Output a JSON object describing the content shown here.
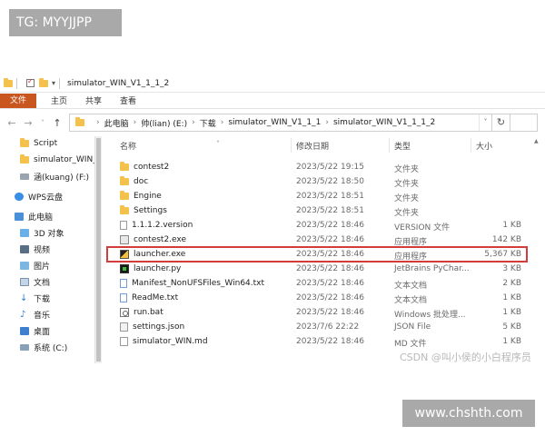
{
  "overlay": {
    "tg_label": "TG: MYYJJPP",
    "site_label": "www.chshth.com",
    "csdn_label": "CSDN @叫小侯的小白程序员"
  },
  "window": {
    "title": "simulator_WIN_V1_1_1_2",
    "quick_access_more": "▾"
  },
  "ribbon": {
    "tabs": [
      "文件",
      "主页",
      "共享",
      "查看"
    ]
  },
  "nav": {
    "back": "←",
    "forward": "→",
    "recent": "˅",
    "up": "↑",
    "refresh": "↻",
    "address_dropdown": "˅"
  },
  "breadcrumb": [
    "此电脑",
    "帅(lian) (E:)",
    "下载",
    "simulator_WIN_V1_1_1",
    "simulator_WIN_V1_1_1_2"
  ],
  "breadcrumb_sep": "›",
  "sidebar": {
    "items": [
      {
        "label": "Script",
        "icon": "folder-icon"
      },
      {
        "label": "simulator_WIN_",
        "icon": "folder-icon"
      },
      {
        "label": "涵(kuang) (F:)",
        "icon": "drive-icon"
      },
      {
        "label": "WPS云盘",
        "icon": "cloud-icon"
      },
      {
        "label": "此电脑",
        "icon": "computer-icon"
      },
      {
        "label": "3D 对象",
        "icon": "3d-objects-icon"
      },
      {
        "label": "视频",
        "icon": "video-icon"
      },
      {
        "label": "图片",
        "icon": "pictures-icon"
      },
      {
        "label": "文档",
        "icon": "documents-icon"
      },
      {
        "label": "下载",
        "icon": "downloads-icon"
      },
      {
        "label": "音乐",
        "icon": "music-icon"
      },
      {
        "label": "桌面",
        "icon": "desktop-icon"
      },
      {
        "label": "系统 (C:)",
        "icon": "system-drive-icon"
      }
    ]
  },
  "columns": {
    "name": "名称",
    "date": "修改日期",
    "type": "类型",
    "size": "大小",
    "sort_indicator": "˄"
  },
  "files": [
    {
      "name": "contest2",
      "date": "2023/5/22 19:15",
      "type": "文件夹",
      "size": "",
      "icon": "folder-icon"
    },
    {
      "name": "doc",
      "date": "2023/5/22 18:50",
      "type": "文件夹",
      "size": "",
      "icon": "folder-icon"
    },
    {
      "name": "Engine",
      "date": "2023/5/22 18:51",
      "type": "文件夹",
      "size": "",
      "icon": "folder-icon"
    },
    {
      "name": "Settings",
      "date": "2023/5/22 18:51",
      "type": "文件夹",
      "size": "",
      "icon": "folder-icon"
    },
    {
      "name": "1.1.1.2.version",
      "date": "2023/5/22 18:46",
      "type": "VERSION 文件",
      "size": "1 KB",
      "icon": "file-icon"
    },
    {
      "name": "contest2.exe",
      "date": "2023/5/22 18:46",
      "type": "应用程序",
      "size": "142 KB",
      "icon": "exe-icon"
    },
    {
      "name": "launcher.exe",
      "date": "2023/5/22 18:46",
      "type": "应用程序",
      "size": "5,367 KB",
      "icon": "launcher-icon",
      "highlighted": true
    },
    {
      "name": "launcher.py",
      "date": "2023/5/22 18:46",
      "type": "JetBrains PyChar...",
      "size": "3 KB",
      "icon": "python-icon"
    },
    {
      "name": "Manifest_NonUFSFiles_Win64.txt",
      "date": "2023/5/22 18:46",
      "type": "文本文档",
      "size": "2 KB",
      "icon": "text-file-icon"
    },
    {
      "name": "ReadMe.txt",
      "date": "2023/5/22 18:46",
      "type": "文本文档",
      "size": "1 KB",
      "icon": "text-file-icon"
    },
    {
      "name": "run.bat",
      "date": "2023/5/22 18:46",
      "type": "Windows 批处理...",
      "size": "1 KB",
      "icon": "batch-file-icon"
    },
    {
      "name": "settings.json",
      "date": "2023/7/6 22:22",
      "type": "JSON File",
      "size": "5 KB",
      "icon": "json-file-icon"
    },
    {
      "name": "simulator_WIN.md",
      "date": "2023/5/22 18:46",
      "type": "MD 文件",
      "size": "1 KB",
      "icon": "markdown-file-icon"
    }
  ],
  "colors": {
    "file_tab": "#c9561e",
    "highlight": "#d23c3c",
    "folder": "#f5c14d"
  }
}
